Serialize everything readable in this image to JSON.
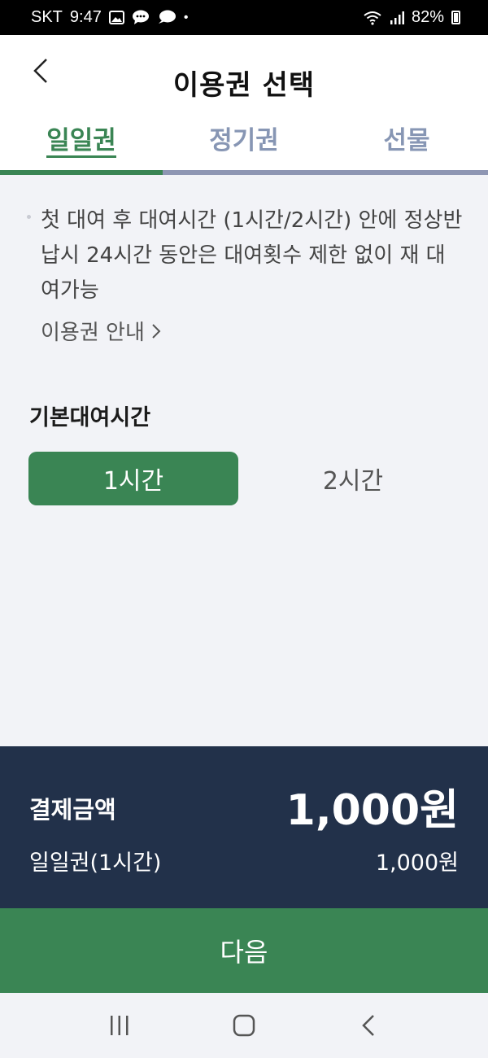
{
  "status_bar": {
    "carrier": "SKT",
    "time": "9:47",
    "dot": "•",
    "battery": "82%",
    "icons": [
      "gallery-icon",
      "message-icon",
      "talk-icon",
      "wifi-icon",
      "signal-icon",
      "battery-icon"
    ]
  },
  "header": {
    "title": "이용권 선택",
    "back_icon": "chevron-left-icon"
  },
  "tabs": [
    {
      "label": "일일권",
      "active": true
    },
    {
      "label": "정기권",
      "active": false
    },
    {
      "label": "선물",
      "active": false
    }
  ],
  "notice": {
    "text": "첫 대여 후 대여시간 (1시간/2시간) 안에 정상반납시 24시간 동안은 대여횟수 제한 없이 재 대여가능",
    "guide_link": "이용권 안내",
    "guide_icon": "chevron-right-icon"
  },
  "rental_time": {
    "title": "기본대여시간",
    "options": [
      {
        "label": "1시간",
        "selected": true
      },
      {
        "label": "2시간",
        "selected": false
      }
    ]
  },
  "payment": {
    "label": "결제금액",
    "total": "1,000원",
    "item": "일일권(1시간)",
    "item_price": "1,000원"
  },
  "next_button": "다음",
  "nav": [
    "recent-apps-icon",
    "home-icon",
    "back-icon"
  ],
  "colors": {
    "accent": "#3a8554",
    "inactive_tab": "#8796b4",
    "payment_bg": "#22314a",
    "page_bg": "#f2f3f7"
  }
}
